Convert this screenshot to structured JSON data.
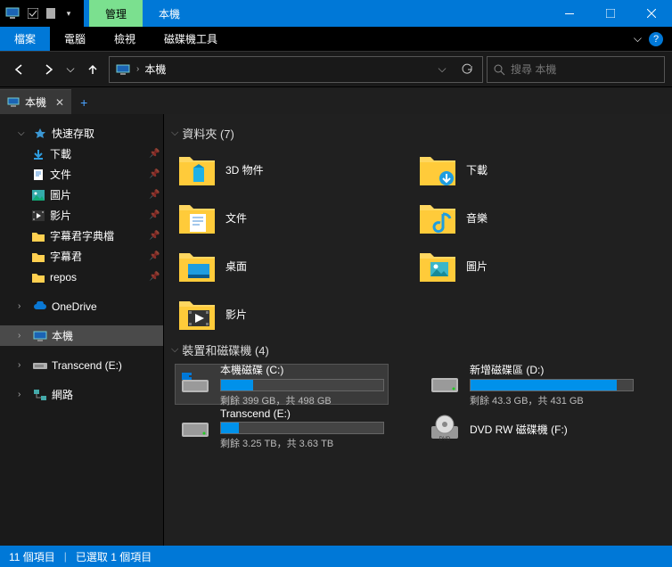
{
  "titlebar": {
    "mgmt_label": "管理",
    "title_label": "本機"
  },
  "ribbon": {
    "file": "檔案",
    "tabs": [
      "電腦",
      "檢視",
      "磁碟機工具"
    ]
  },
  "addressbar": {
    "path": "本機"
  },
  "search": {
    "placeholder": "搜尋 本機"
  },
  "doctab": {
    "label": "本機"
  },
  "sidebar": {
    "quick_access": "快速存取",
    "items": [
      {
        "label": "下載",
        "pin": true,
        "icon": "download"
      },
      {
        "label": "文件",
        "pin": true,
        "icon": "doc"
      },
      {
        "label": "圖片",
        "pin": true,
        "icon": "pic"
      },
      {
        "label": "影片",
        "pin": true,
        "icon": "vid"
      },
      {
        "label": "字幕君字典檔",
        "pin": true,
        "icon": "folder"
      },
      {
        "label": "字幕君",
        "pin": true,
        "icon": "folder"
      },
      {
        "label": "repos",
        "pin": true,
        "icon": "folder"
      }
    ],
    "onedrive": "OneDrive",
    "this_pc": "本機",
    "transcend": "Transcend (E:)",
    "network": "網路"
  },
  "content": {
    "folders_header": "資料夾 (7)",
    "folders": [
      {
        "label": "3D 物件"
      },
      {
        "label": "下載"
      },
      {
        "label": "文件"
      },
      {
        "label": "音樂"
      },
      {
        "label": "桌面"
      },
      {
        "label": "圖片"
      },
      {
        "label": "影片"
      }
    ],
    "drives_header": "裝置和磁碟機 (4)",
    "drives": [
      {
        "name": "本機磁碟 (C:)",
        "stats": "剩餘 399 GB，共 498 GB",
        "fill": 20,
        "type": "ssd",
        "sel": true
      },
      {
        "name": "新增磁碟區 (D:)",
        "stats": "剩餘 43.3 GB，共 431 GB",
        "fill": 90,
        "type": "hdd"
      },
      {
        "name": "Transcend (E:)",
        "stats": "剩餘 3.25 TB，共 3.63 TB",
        "fill": 11,
        "type": "hdd"
      },
      {
        "name": "DVD RW 磁碟機 (F:)",
        "stats": "",
        "fill": -1,
        "type": "dvd"
      }
    ]
  },
  "statusbar": {
    "count": "11 個項目",
    "selection": "已選取 1 個項目"
  }
}
